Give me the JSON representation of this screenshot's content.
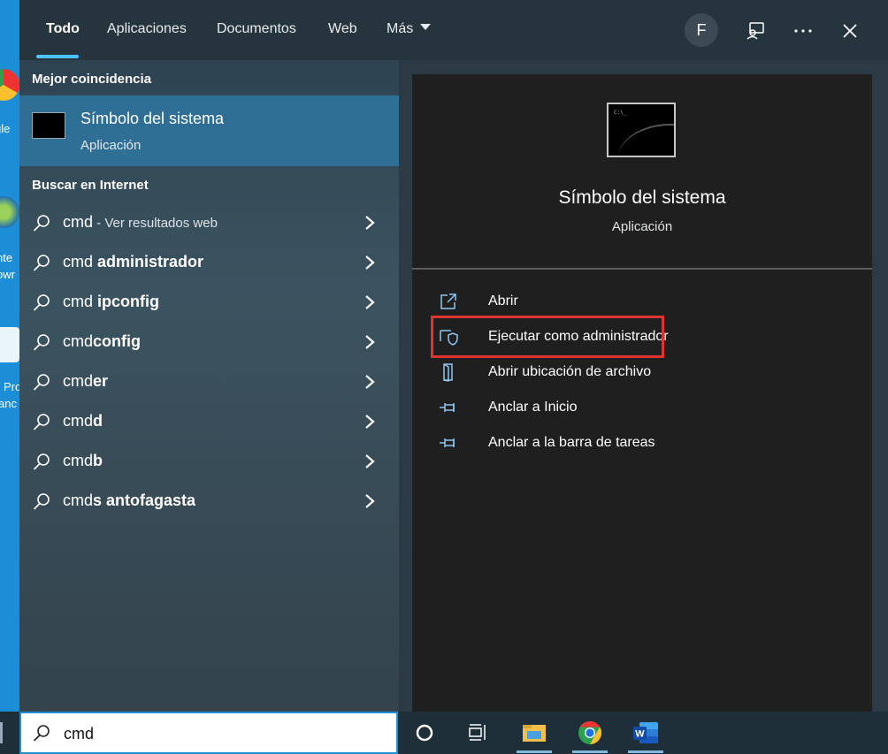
{
  "desktop": {
    "items": [
      {
        "label": "gle"
      },
      {
        "label": "nte"
      },
      {
        "label": "owr"
      },
      {
        "label": "Pro"
      },
      {
        "label": "anc"
      }
    ]
  },
  "tabs": [
    {
      "label": "Todo",
      "active": true
    },
    {
      "label": "Aplicaciones"
    },
    {
      "label": "Documentos"
    },
    {
      "label": "Web"
    },
    {
      "label": "Más"
    }
  ],
  "user": {
    "initial": "F"
  },
  "header_icons": [
    "feedback-icon",
    "more-icon",
    "close-icon"
  ],
  "best_match": {
    "heading": "Mejor coincidencia",
    "title": "Símbolo del sistema",
    "subtitle": "Aplicación"
  },
  "web": {
    "heading": "Buscar en Internet",
    "results": [
      {
        "prefix": "cmd",
        "bold": "",
        "muted": " - Ver resultados web"
      },
      {
        "prefix": "cmd ",
        "bold": "administrador",
        "muted": ""
      },
      {
        "prefix": "cmd ",
        "bold": "ipconfig",
        "muted": ""
      },
      {
        "prefix": "cmd",
        "bold": "config",
        "muted": ""
      },
      {
        "prefix": "cmd",
        "bold": "er",
        "muted": ""
      },
      {
        "prefix": "cmd",
        "bold": "d",
        "muted": ""
      },
      {
        "prefix": "cmd",
        "bold": "b",
        "muted": ""
      },
      {
        "prefix": "cmd",
        "bold": "s antofagasta",
        "muted": ""
      }
    ]
  },
  "details": {
    "title": "Símbolo del sistema",
    "subtitle": "Aplicación",
    "actions": [
      {
        "label": "Abrir",
        "icon": "open-icon"
      },
      {
        "label": "Ejecutar como administrador",
        "icon": "shield-icon"
      },
      {
        "label": "Abrir ubicación de archivo",
        "icon": "file-location-icon"
      },
      {
        "label": "Anclar a Inicio",
        "icon": "pin-icon"
      },
      {
        "label": "Anclar a la barra de tareas",
        "icon": "pin-icon"
      }
    ],
    "highlight_color": "#e0332f"
  },
  "search": {
    "value": "cmd"
  },
  "taskbar": {
    "apps": [
      "cortana-icon",
      "task-view-icon",
      "file-explorer-icon",
      "chrome-icon",
      "word-icon"
    ]
  },
  "colors": {
    "accent": "#4cc2ff",
    "selected": "#2f6f95"
  }
}
